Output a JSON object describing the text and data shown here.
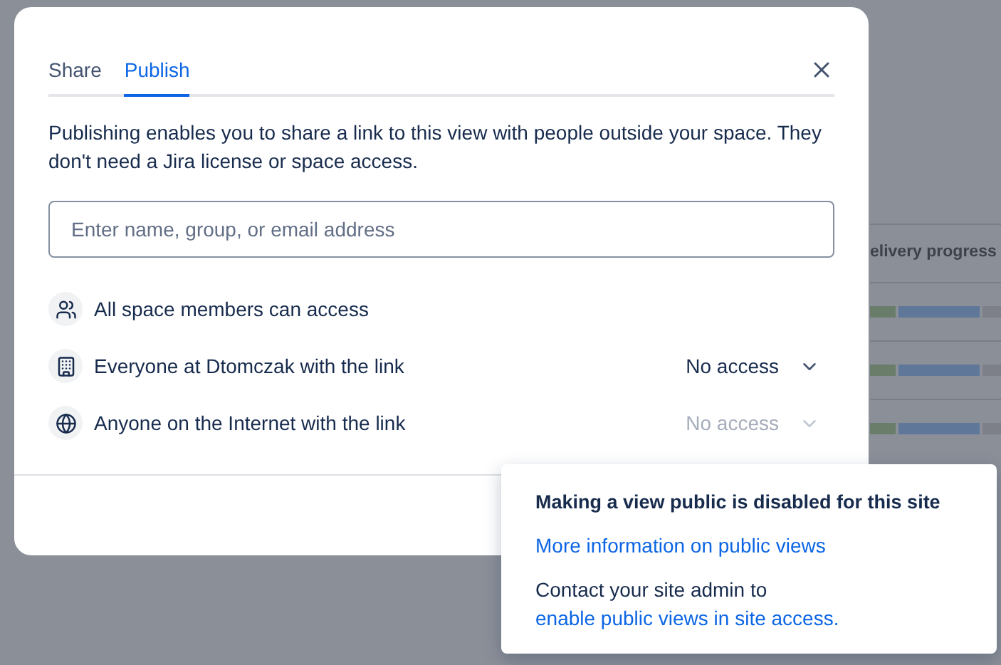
{
  "background": {
    "column_header": "elivery progress",
    "progress_rows": [
      {
        "segments": [
          {
            "color": "#6a7d6a",
            "level": 0.22
          },
          {
            "color": "#5f7799",
            "level": 0.86
          }
        ]
      },
      {
        "segments": [
          {
            "color": "#6a7d6a",
            "level": 0.22
          },
          {
            "color": "#5f7799",
            "level": 0.86
          }
        ]
      },
      {
        "segments": [
          {
            "color": "#6a7d6a",
            "level": 0.22
          },
          {
            "color": "#5f7799",
            "level": 0.86
          }
        ]
      }
    ]
  },
  "dialog": {
    "tabs": [
      {
        "label": "Share",
        "selected": false
      },
      {
        "label": "Publish",
        "selected": true
      }
    ],
    "description": "Publishing enables you to share a link to this view with people outside your space. They don't need a Jira license or space access.",
    "search": {
      "placeholder": "Enter name, group, or email address"
    },
    "access_rows": [
      {
        "kind": "members",
        "label": "All space members can access"
      },
      {
        "kind": "organization",
        "label": "Everyone at Dtomczak with the link",
        "dropdown": {
          "value": "No access",
          "disabled": false
        }
      },
      {
        "kind": "internet",
        "label": "Anyone on the Internet with the link",
        "dropdown": {
          "value": "No access",
          "disabled": true
        }
      }
    ]
  },
  "popover": {
    "title": "Making a view public is disabled for this site",
    "link": "More information on public views",
    "message": "Contact your site admin to",
    "message_link": "enable public views in site access."
  }
}
